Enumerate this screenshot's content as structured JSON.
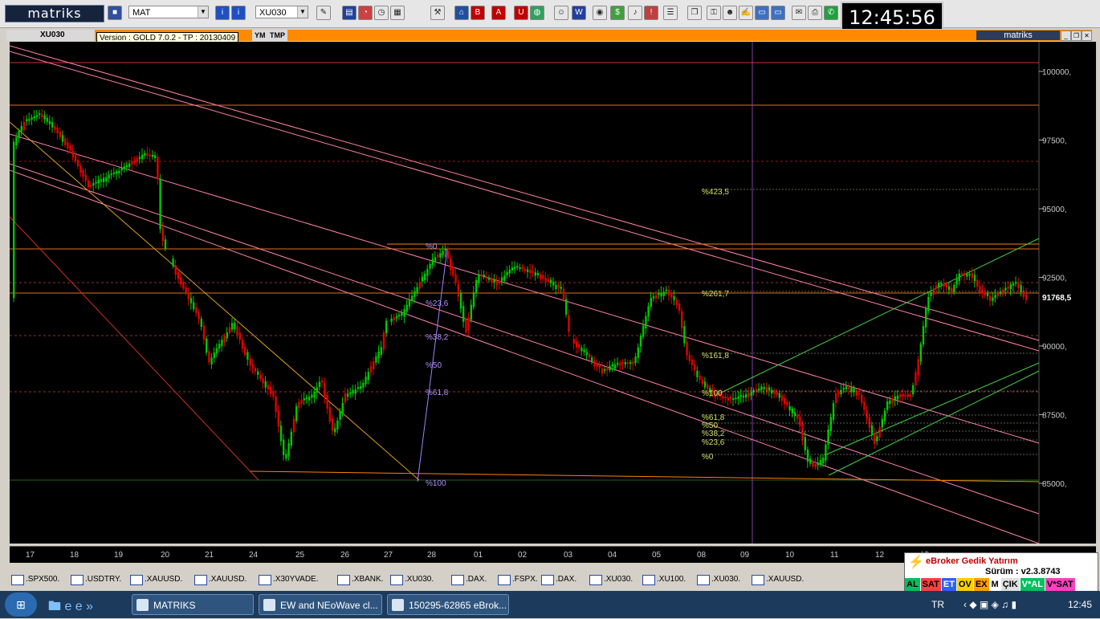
{
  "toolbar": {
    "logo": "matriks",
    "template_combo": "MAT",
    "symbol_combo": "XU030",
    "clock": "12:45:56"
  },
  "chart_window": {
    "symbol": "XU030",
    "tags": [
      "YM",
      "TMP"
    ],
    "logo": "matriks",
    "tooltip": "Version : GOLD 7.0.2 - TP : 20130409"
  },
  "chart_data": {
    "type": "candlestick",
    "price_ticks": [
      "100000,",
      "97500,",
      "95000,",
      "92500,",
      "90000,",
      "87500,",
      "85000,"
    ],
    "last_price": "91768,5",
    "dates": [
      "17",
      "18",
      "19",
      "20",
      "21",
      "24",
      "25",
      "26",
      "27",
      "28",
      "01",
      "02",
      "03",
      "04",
      "05",
      "08",
      "09",
      "10",
      "11",
      "12",
      "15"
    ],
    "fib_levels_1": [
      "%0",
      "%23,6",
      "%38,2",
      "%50",
      "%61,8",
      "%100"
    ],
    "fib_levels_2": [
      "%423,5",
      "%261,7",
      "%161,8",
      "%100",
      "%61,8",
      "%50",
      "%38,2",
      "%23,6",
      "%0"
    ],
    "colors": {
      "up": "#00c800",
      "down": "#e00000",
      "background": "#000000"
    }
  },
  "symbols_bar": [
    ".SPX500.",
    ".USDTRY.",
    ".XAUUSD.",
    ".XAUUSD.",
    ".X30YVADE.",
    ".XBANK.",
    ".XU030.",
    ".DAX.",
    ".FSPX.",
    ".DAX.",
    ".XU030.",
    ".XU100.",
    ".XU030.",
    ".XAUUSD."
  ],
  "ebroker": {
    "title": "eBroker Gedik Yatırım",
    "version": "Sürüm : v2.3.8743",
    "buttons": [
      "AL",
      "SAT",
      "ET",
      "OV",
      "EX",
      "M",
      "ÇIK",
      "V*AL",
      "V*SAT"
    ]
  },
  "taskbar": {
    "tasks": [
      "MATRIKS",
      "EW and NEoWave cl...",
      "150295-62865 eBrok..."
    ],
    "lang": "TR",
    "time": "12:45"
  }
}
